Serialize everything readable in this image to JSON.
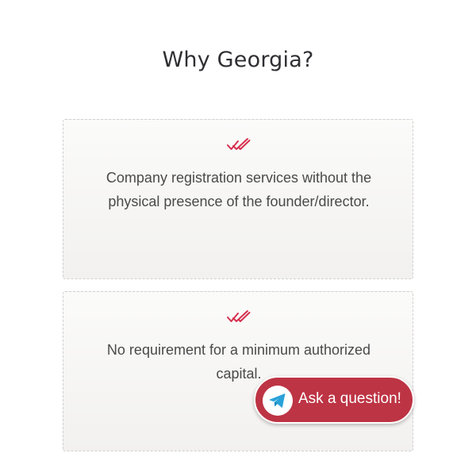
{
  "section": {
    "title": "Why Georgia?"
  },
  "cards": [
    {
      "icon": "double-check-icon",
      "text": "Company registration services without the physical presence of the founder/director."
    },
    {
      "icon": "double-check-icon",
      "text": "No requirement for a minimum authorized capital."
    }
  ],
  "ask_widget": {
    "icon": "telegram-icon",
    "label": "Ask a question!"
  },
  "colors": {
    "accent": "#bd3444",
    "check": "#d6304f",
    "telegram": "#2aa2d8",
    "text": "#4a4a4a",
    "title": "#2f2f33"
  }
}
